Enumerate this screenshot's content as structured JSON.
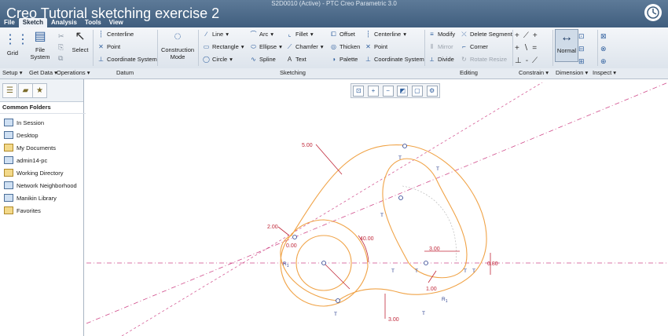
{
  "video": {
    "title": "Creo Tutorial sketching exercise 2"
  },
  "window": {
    "title": "S2D0010 (Active) - PTC Creo Parametric 3.0"
  },
  "tabs": [
    "File",
    "Sketch",
    "Analysis",
    "Tools",
    "View"
  ],
  "ribbon": {
    "setup": {
      "grid": "Grid",
      "file_system": "File System",
      "select": "Select"
    },
    "datum": {
      "centerline": "Centerline",
      "point": "Point",
      "coordinate_system": "Coordinate System"
    },
    "construction_mode": "Construction Mode",
    "sketching": {
      "line": "Line",
      "rectangle": "Rectangle",
      "circle": "Circle",
      "arc": "Arc",
      "ellipse": "Ellipse",
      "spline": "Spline",
      "fillet": "Fillet",
      "chamfer": "Chamfer",
      "text": "Text",
      "offset": "Offset",
      "thicken": "Thicken",
      "palette": "Palette",
      "centerline": "Centerline",
      "point": "Point",
      "coordinate_system": "Coordinate System"
    },
    "editing": {
      "modify": "Modify",
      "mirror": "Mirror",
      "divide": "Divide",
      "delete_segment": "Delete Segment",
      "corner": "Corner",
      "rotate_resize": "Rotate Resize"
    },
    "dimension": {
      "normal": "Normal"
    }
  },
  "groups": [
    "Setup",
    "Get Data",
    "Operations",
    "Datum",
    "Sketching",
    "Editing",
    "Constrain",
    "Dimension",
    "Inspect"
  ],
  "sidebar": {
    "heading": "Common Folders",
    "folders": [
      "In Session",
      "Desktop",
      "My Documents",
      "admin14-pc",
      "Working Directory",
      "Network Neighborhood",
      "Manikin Library",
      "Favorites"
    ]
  },
  "sketch": {
    "dims": {
      "d1": "5.00",
      "d2": "2.00",
      "d3": "0.00",
      "d4": "40.00",
      "d5": "3.00",
      "d6": "0.80",
      "d7": "1.00",
      "d8": "3.00"
    },
    "r1": "R",
    "r1_sub": "1",
    "tangent": "T"
  },
  "colors": {
    "header": "#4a6888",
    "sketch_line": "#f0a347",
    "construction_line": "#d04a8a",
    "dimension": "#c0283a",
    "constraint": "#2a3f8f"
  }
}
